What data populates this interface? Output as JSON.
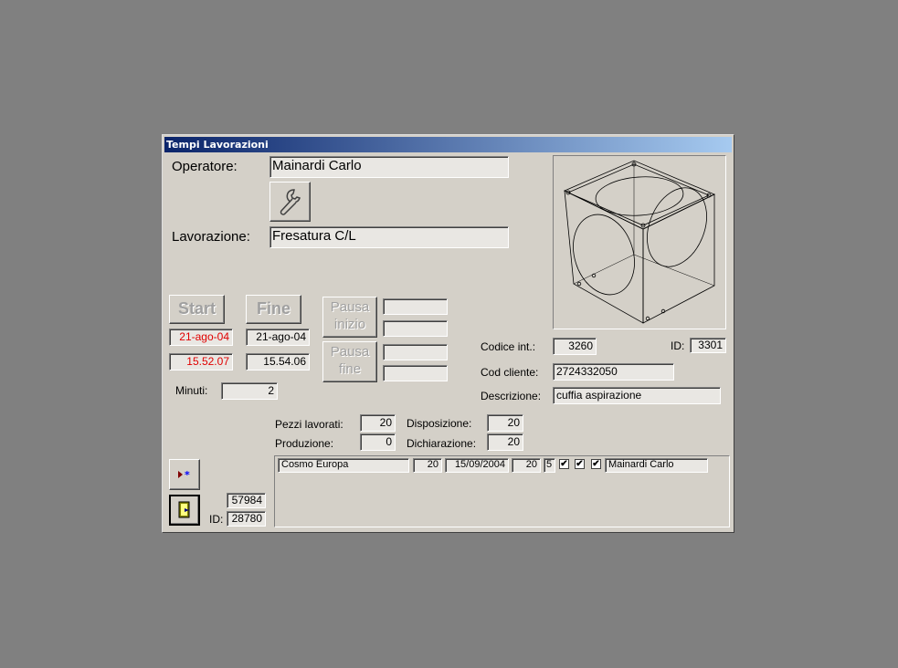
{
  "window": {
    "title": "Tempi Lavorazioni"
  },
  "operatore": {
    "label": "Operatore:",
    "value": "Mainardi Carlo"
  },
  "lavorazione": {
    "label": "Lavorazione:",
    "value": "Fresatura C/L"
  },
  "buttons": {
    "start": "Start",
    "fine": "Fine",
    "pausa_inizio_line1": "Pausa",
    "pausa_inizio_line2": "inizio",
    "pausa_fine_line1": "Pausa",
    "pausa_fine_line2": "fine",
    "wrench_icon": "wrench-icon",
    "new_record_icon": "new-record-icon",
    "exit_icon": "exit-door-icon"
  },
  "start": {
    "date": "21-ago-04",
    "time": "15.52.07",
    "color": "#e00000"
  },
  "fine": {
    "date": "21-ago-04",
    "time": "15.54.06"
  },
  "pausa": {
    "inizio": "",
    "inizio2": "",
    "fine": "",
    "fine2": ""
  },
  "minuti": {
    "label": "Minuti:",
    "value": "2"
  },
  "codice_int": {
    "label": "Codice  int.:",
    "value": "3260"
  },
  "id_articolo": {
    "label": "ID:",
    "value": "3301"
  },
  "cod_cliente": {
    "label": "Cod cliente:",
    "value": "2724332050"
  },
  "descrizione": {
    "label": "Descrizione:",
    "value": "cuffia aspirazione"
  },
  "pezzi_lavorati": {
    "label": "Pezzi lavorati:",
    "value": "20"
  },
  "produzione": {
    "label": "Produzione:",
    "value": "0"
  },
  "disposizione": {
    "label": "Disposizione:",
    "value": "20"
  },
  "dichiarazione": {
    "label": "Dichiarazione:",
    "value": "20"
  },
  "subform_row": {
    "cliente": "Cosmo Europa",
    "qta": "20",
    "data": "15/09/2004",
    "qta2": "20",
    "num": "5",
    "check1": "✔",
    "check2": "✔",
    "check3": "✔",
    "operatore": "Mainardi Carlo"
  },
  "footer": {
    "record": "57984",
    "id_label": "ID:",
    "id_value": "28780"
  }
}
